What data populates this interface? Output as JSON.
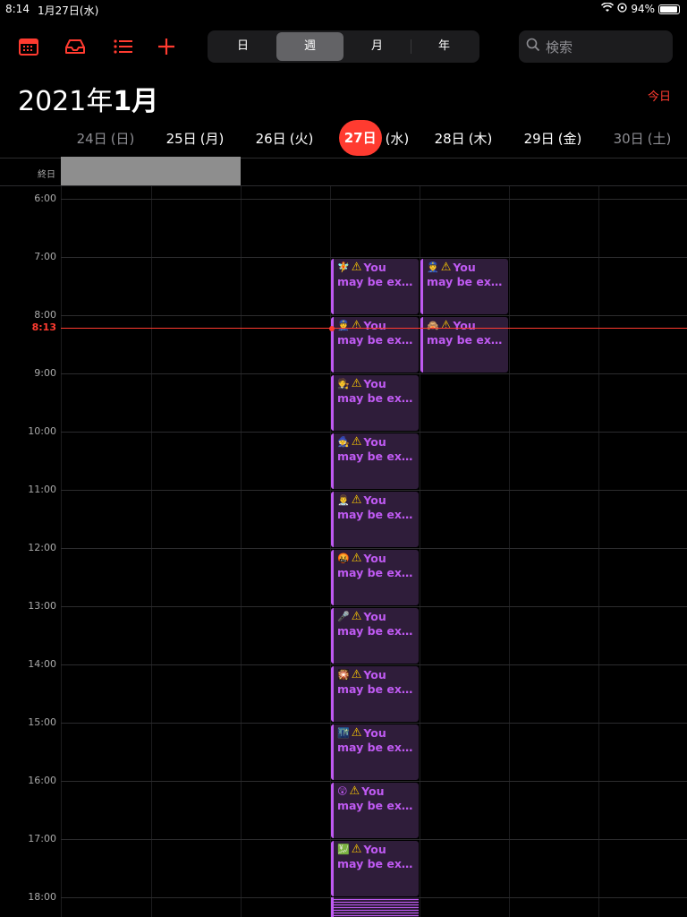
{
  "status_bar": {
    "time": "8:14",
    "date": "1月27日(水)",
    "battery": "94%",
    "battery_level": 0.94
  },
  "toolbar": {
    "icons": [
      "calendar-icon",
      "inbox-icon",
      "list-icon",
      "add-icon"
    ],
    "segments": [
      "日",
      "週",
      "月",
      "年"
    ],
    "active_segment": "週",
    "search_placeholder": "検索"
  },
  "header": {
    "year": "2021年",
    "month": "1月",
    "today_button": "今日"
  },
  "days": [
    {
      "num": "24日",
      "wd": "(日)"
    },
    {
      "num": "25日",
      "wd": "(月)"
    },
    {
      "num": "26日",
      "wd": "(火)"
    },
    {
      "num": "27日",
      "wd": "(水)"
    },
    {
      "num": "28日",
      "wd": "(木)"
    },
    {
      "num": "29日",
      "wd": "(金)"
    },
    {
      "num": "30日",
      "wd": "(土)"
    }
  ],
  "allday_label": "終日",
  "hours": [
    "6:00",
    "7:00",
    "8:00",
    "9:00",
    "10:00",
    "11:00",
    "12:00",
    "13:00",
    "14:00",
    "15:00",
    "16:00",
    "17:00",
    "18:00"
  ],
  "current_time": "8:13",
  "event_text": {
    "word1": "You",
    "rest": "may be exposed onli..."
  },
  "events": [
    {
      "day": "27日",
      "start": "7:00",
      "emoji": "🧚"
    },
    {
      "day": "28日",
      "start": "7:00",
      "emoji": "👮"
    },
    {
      "day": "27日",
      "start": "8:00",
      "emoji": "👮"
    },
    {
      "day": "28日",
      "start": "8:00",
      "emoji": "🙈"
    },
    {
      "day": "27日",
      "start": "9:00",
      "emoji": "🧑‍⚖️"
    },
    {
      "day": "27日",
      "start": "10:00",
      "emoji": "🧙"
    },
    {
      "day": "27日",
      "start": "11:00",
      "emoji": "👨‍⚕️"
    },
    {
      "day": "27日",
      "start": "12:00",
      "emoji": "🤬"
    },
    {
      "day": "27日",
      "start": "13:00",
      "emoji": "🎤"
    },
    {
      "day": "27日",
      "start": "14:00",
      "emoji": "🎇"
    },
    {
      "day": "27日",
      "start": "15:00",
      "emoji": "🌃"
    },
    {
      "day": "27日",
      "start": "16:00",
      "emoji": "😲"
    },
    {
      "day": "27日",
      "start": "17:00",
      "emoji": "💹"
    }
  ]
}
